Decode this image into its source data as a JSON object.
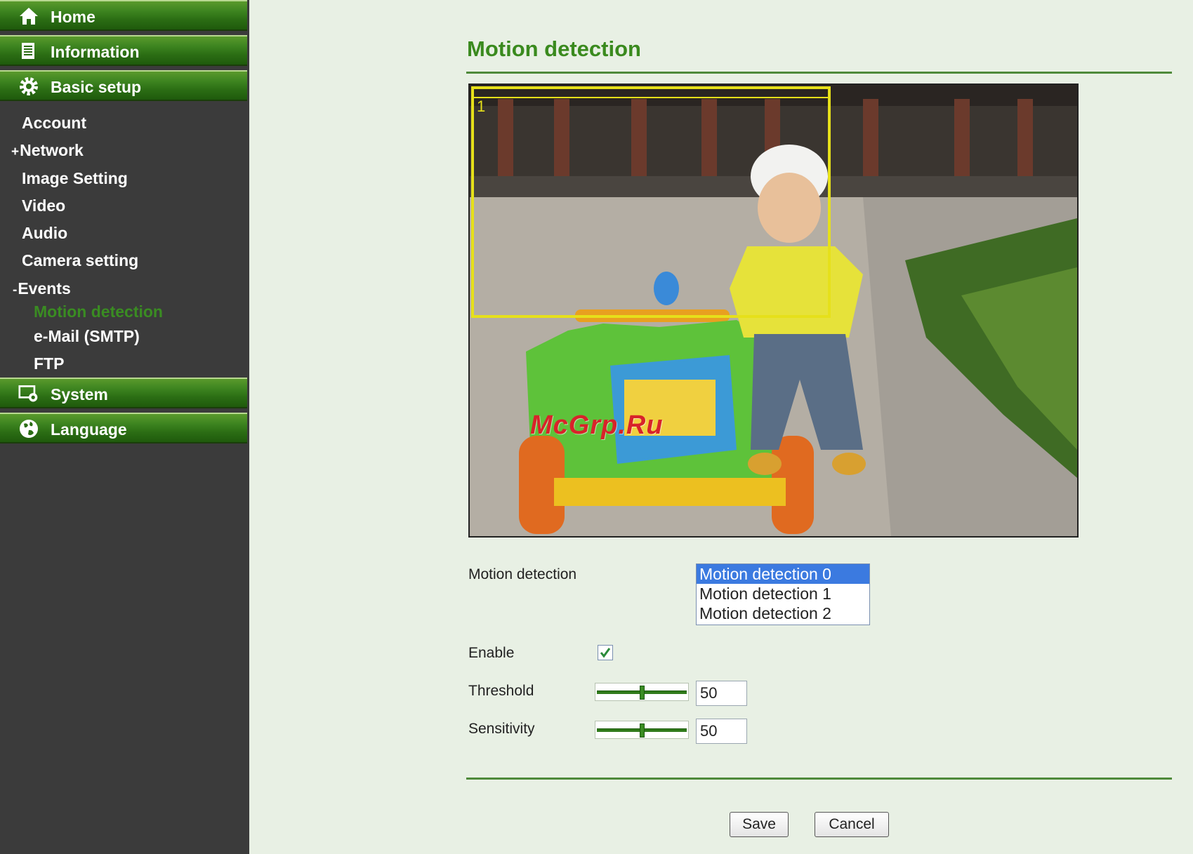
{
  "sidebar": {
    "home": "Home",
    "information": "Information",
    "basic_setup": "Basic setup",
    "items": [
      {
        "marker": "",
        "label": "Account"
      },
      {
        "marker": "+",
        "label": "Network"
      },
      {
        "marker": "",
        "label": "Image Setting"
      },
      {
        "marker": "",
        "label": "Video"
      },
      {
        "marker": "",
        "label": "Audio"
      },
      {
        "marker": "",
        "label": "Camera setting"
      },
      {
        "marker": "-",
        "label": "Events"
      }
    ],
    "events_sub": [
      "Motion detection",
      "e-Mail (SMTP)",
      "FTP"
    ],
    "system": "System",
    "language": "Language",
    "icons": {
      "home": "home-icon",
      "information": "document-icon",
      "basic_setup": "gear-icon",
      "system": "system-icon",
      "language": "globe-icon"
    }
  },
  "main": {
    "title": "Motion detection",
    "region_number": "1",
    "watermark": "McGrp.Ru",
    "motion_label": "Motion detection",
    "motion_options": [
      "Motion detection 0",
      "Motion detection 1",
      "Motion detection 2"
    ],
    "selected_option": "Motion detection 0",
    "enable_label": "Enable",
    "enable_checked": true,
    "threshold_label": "Threshold",
    "threshold_value": "50",
    "sensitivity_label": "Sensitivity",
    "sensitivity_value": "50",
    "save": "Save",
    "cancel": "Cancel"
  },
  "colors": {
    "accent_green": "#3a8a1e",
    "nav_green": "#2b6d14",
    "sidebar_bg": "#3b3b3b",
    "page_bg": "#e8f0e4",
    "selection_blue": "#3b7ae0",
    "region_yellow": "#e6e01a",
    "watermark_red": "#d8232a"
  }
}
